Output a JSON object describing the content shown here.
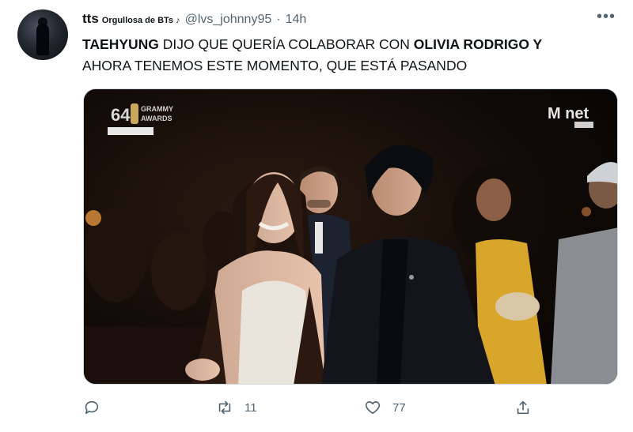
{
  "tweet": {
    "display_name": "tts",
    "display_name_small": "Orgullosa de BTs ♪",
    "handle": "@lvs_johnny95",
    "separator": "·",
    "time": "14h",
    "text_part1": "TAEHYUNG",
    "text_part2": " DIJO QUE QUERÍA COLABORAR CON ",
    "text_part3": "OLIVIA RODRIGO Y",
    "text_part4": "AHORA TENEMOS ESTE MOMENTO, QUE ESTÁ PASANDO"
  },
  "media": {
    "logo_number": "64",
    "logo_text_1": "GRAMMY",
    "logo_text_2": "AWARDS",
    "broadcaster": "M net"
  },
  "actions": {
    "reply_icon": "reply-icon",
    "retweet_icon": "retweet-icon",
    "retweet_count": "11",
    "like_icon": "heart-icon",
    "like_count": "77",
    "share_icon": "share-icon"
  }
}
